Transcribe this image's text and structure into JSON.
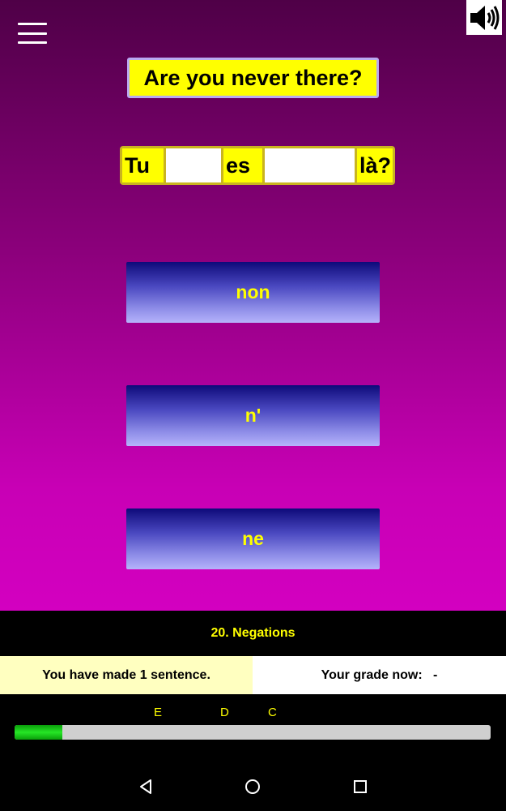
{
  "prompt": {
    "english": "Are you never there?"
  },
  "sentence": {
    "word_1": "Tu",
    "blank_1": "",
    "word_2": "es",
    "blank_2": "",
    "word_3": "là?"
  },
  "answers": [
    {
      "label": "non"
    },
    {
      "label": "n'"
    },
    {
      "label": "ne"
    }
  ],
  "lesson": {
    "title": "20. Negations"
  },
  "status": {
    "sentences_made": "You have made 1 sentence.",
    "grade": "Your grade now:   -"
  },
  "progress": {
    "grade_marks": [
      "E",
      "D",
      "C"
    ],
    "fraction": 0.1
  },
  "icons": {
    "menu": "hamburger-menu-icon",
    "sound": "speaker-volume-icon",
    "back": "triangle-back-icon",
    "home": "circle-home-icon",
    "recents": "square-recents-icon"
  },
  "colors": {
    "accent_text": "#ffff00",
    "progress_fill": "#22dd22",
    "prompt_bg": "#ffff00"
  }
}
